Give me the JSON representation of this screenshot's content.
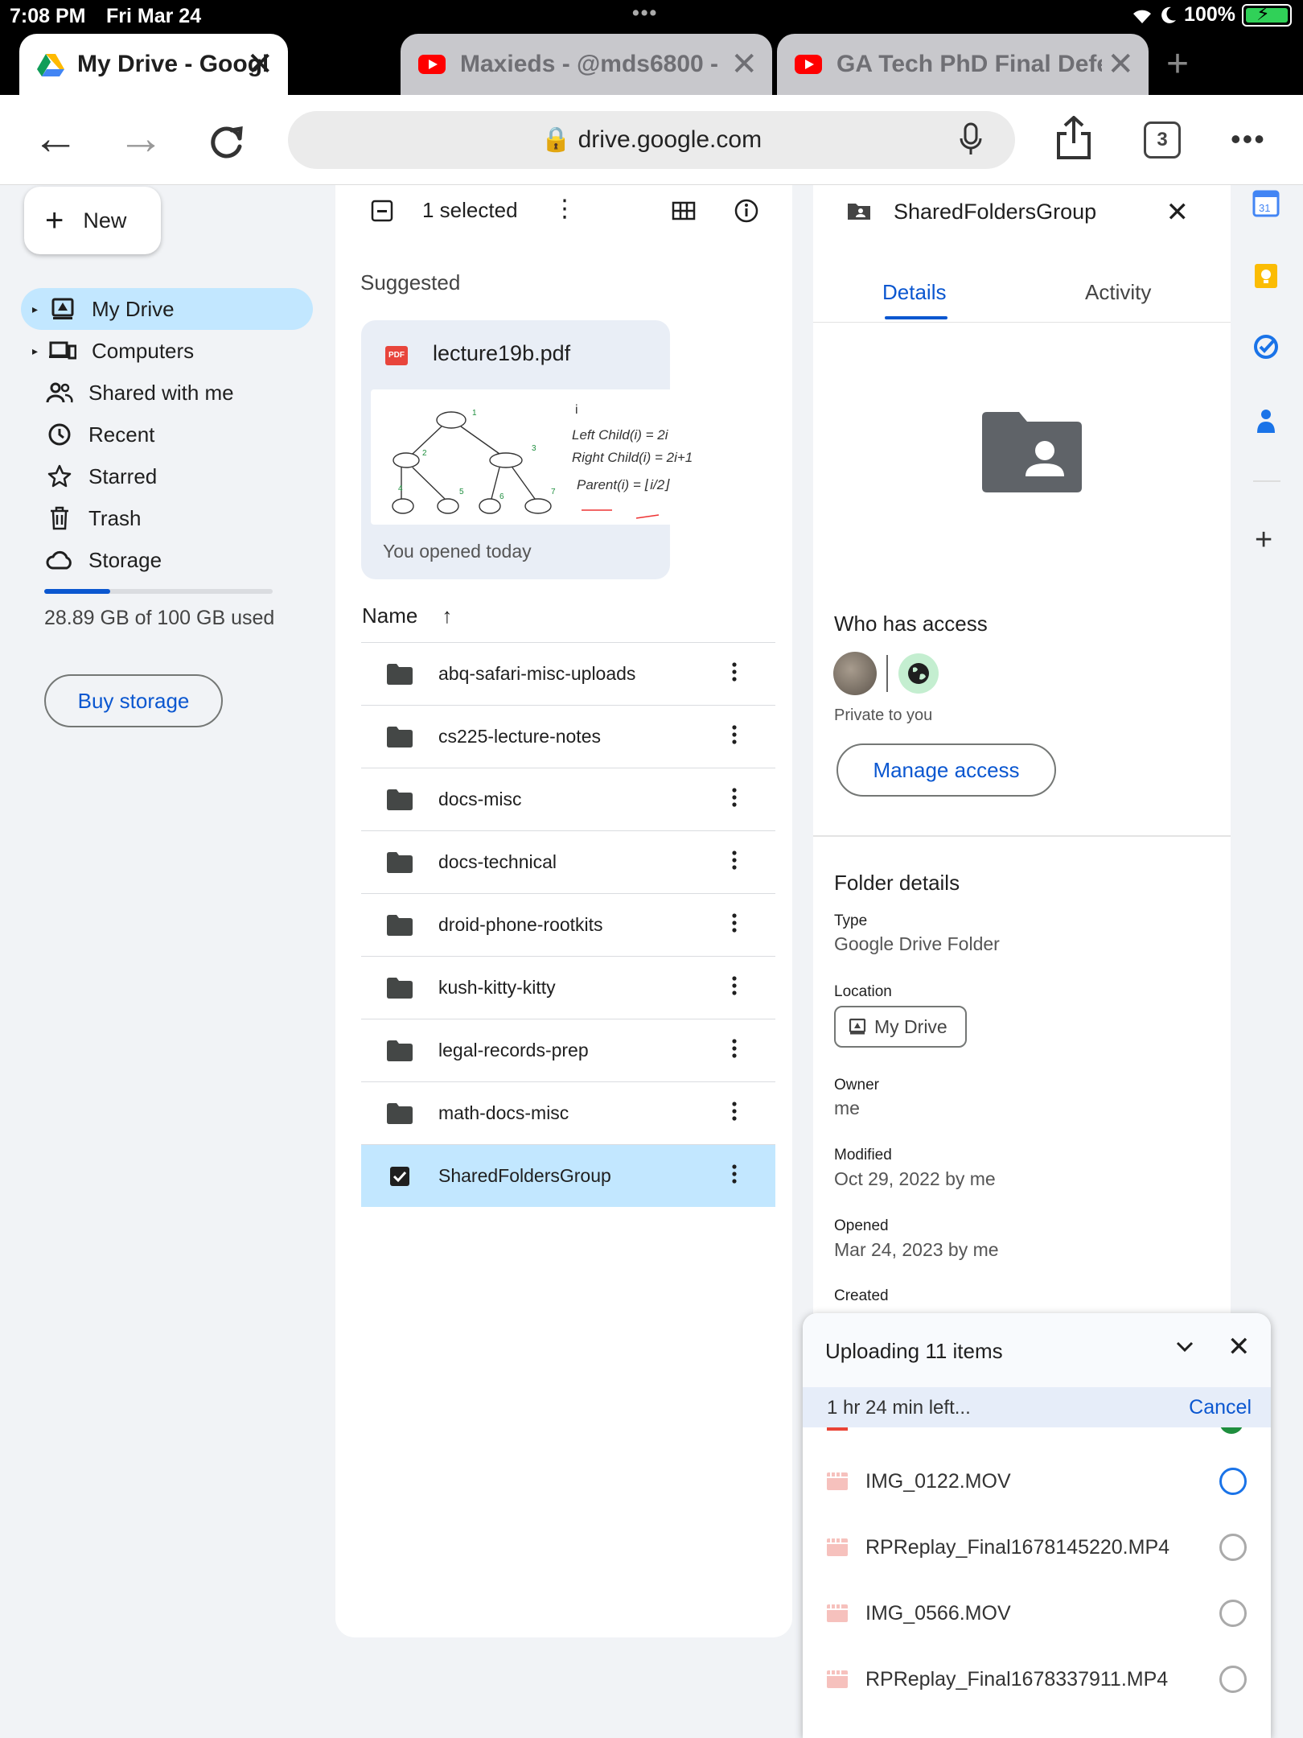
{
  "status_bar": {
    "time": "7:08 PM",
    "date": "Fri Mar 24",
    "battery": "100%"
  },
  "browser": {
    "tabs": [
      {
        "title": "My Drive - Google Drive",
        "active": true,
        "icon": "google-drive-icon"
      },
      {
        "title": "Maxieds - @mds6800 -",
        "active": false,
        "icon": "youtube-icon"
      },
      {
        "title": "GA Tech PhD Final Defer",
        "active": false,
        "icon": "youtube-icon"
      }
    ],
    "url": "drive.google.com",
    "tab_count": "3"
  },
  "sidebar": {
    "new_label": "New",
    "items": [
      {
        "label": "My Drive",
        "icon": "my-drive-icon",
        "active": true
      },
      {
        "label": "Computers",
        "icon": "computers-icon",
        "active": false
      },
      {
        "label": "Shared with me",
        "icon": "shared-icon",
        "active": false
      },
      {
        "label": "Recent",
        "icon": "clock-icon",
        "active": false
      },
      {
        "label": "Starred",
        "icon": "star-icon",
        "active": false
      },
      {
        "label": "Trash",
        "icon": "trash-icon",
        "active": false
      },
      {
        "label": "Storage",
        "icon": "cloud-icon",
        "active": false
      }
    ],
    "storage_used": "28.89 GB of 100 GB used",
    "storage_fraction": 0.2889,
    "buy_storage": "Buy storage"
  },
  "file_pane": {
    "selected_text": "1 selected",
    "suggested_label": "Suggested",
    "suggested_file": {
      "name": "lecture19b.pdf",
      "badge": "PDF",
      "subtitle": "You opened today"
    },
    "sort_label": "Name",
    "files": [
      {
        "name": "abq-safari-misc-uploads",
        "selected": false
      },
      {
        "name": "cs225-lecture-notes",
        "selected": false
      },
      {
        "name": "docs-misc",
        "selected": false
      },
      {
        "name": "docs-technical",
        "selected": false
      },
      {
        "name": "droid-phone-rootkits",
        "selected": false
      },
      {
        "name": "kush-kitty-kitty",
        "selected": false
      },
      {
        "name": "legal-records-prep",
        "selected": false
      },
      {
        "name": "math-docs-misc",
        "selected": false
      },
      {
        "name": "SharedFoldersGroup",
        "selected": true
      }
    ]
  },
  "details": {
    "title": "SharedFoldersGroup",
    "tabs": [
      "Details",
      "Activity"
    ],
    "who_has_access": "Who has access",
    "private_text": "Private to you",
    "manage_access": "Manage access",
    "folder_details": "Folder details",
    "type_label": "Type",
    "type_value": "Google Drive Folder",
    "location_label": "Location",
    "location_value": "My Drive",
    "owner_label": "Owner",
    "owner_value": "me",
    "modified_label": "Modified",
    "modified_value": "Oct 29, 2022 by me",
    "opened_label": "Opened",
    "opened_value": "Mar 24, 2023 by me",
    "created_label": "Created"
  },
  "upload": {
    "title": "Uploading 11 items",
    "time_left": "1 hr 24 min left...",
    "cancel": "Cancel",
    "items": [
      {
        "name": "IMG_0122.MOV",
        "status": "in-progress"
      },
      {
        "name": "RPReplay_Final1678145220.MP4",
        "status": "pending"
      },
      {
        "name": "IMG_0566.MOV",
        "status": "pending"
      },
      {
        "name": "RPReplay_Final1678337911.MP4",
        "status": "pending"
      }
    ]
  },
  "colors": {
    "accent": "#0b57d0",
    "selected_bg": "#c2e7ff",
    "folder": "#5f6368"
  }
}
